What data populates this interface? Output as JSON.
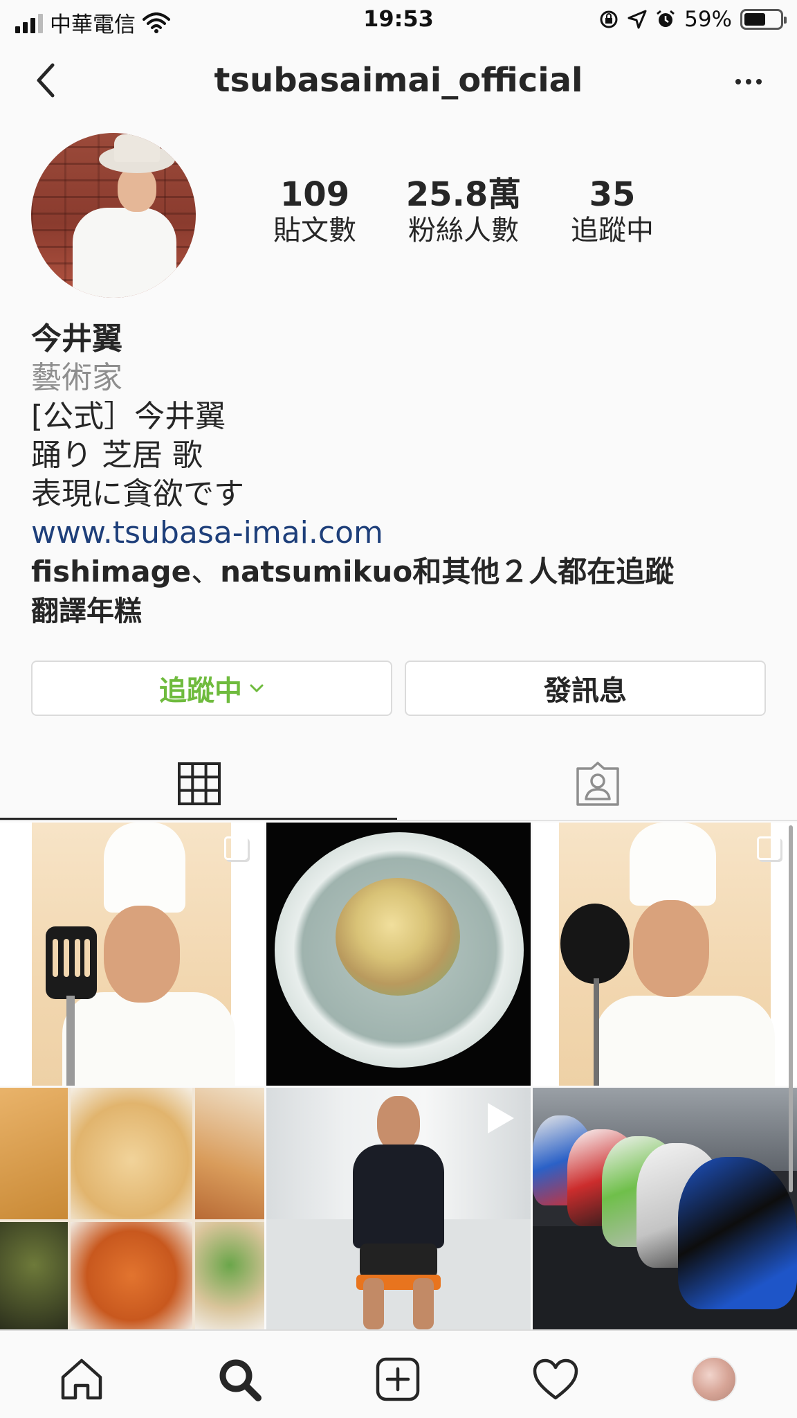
{
  "status_bar": {
    "carrier": "中華電信",
    "time": "19:53",
    "battery_percent": "59%",
    "battery_level": 0.59,
    "icons": [
      "signal-icon",
      "wifi-icon",
      "screen-lock-icon",
      "location-icon",
      "alarm-icon",
      "battery-icon"
    ]
  },
  "header": {
    "username": "tsubasaimai_official",
    "back_icon": "chevron-left-icon",
    "more_icon": "more-horizontal-icon"
  },
  "profile": {
    "stats": [
      {
        "value": "109",
        "label": "貼文數"
      },
      {
        "value": "25.8萬",
        "label": "粉絲人數"
      },
      {
        "value": "35",
        "label": "追蹤中"
      }
    ],
    "name": "今井翼",
    "category": "藝術家",
    "bio_lines": [
      "[公式］今井翼",
      "踊り 芝居 歌",
      "表現に貪欲です"
    ],
    "website": "www.tsubasa-imai.com",
    "followed_by": {
      "user1": "fishimage",
      "separator": "、",
      "user2": "natsumikuo",
      "suffix": "和其他２人都在追蹤"
    },
    "translate": "翻譯年糕"
  },
  "actions": {
    "following_label": "追蹤中",
    "message_label": "發訊息",
    "following_color": "#6fbb3e"
  },
  "tabs": [
    {
      "name": "posts-grid",
      "icon": "grid-icon",
      "active": true
    },
    {
      "name": "tagged",
      "icon": "tagged-person-icon",
      "active": false
    }
  ],
  "posts": [
    {
      "kind": "image",
      "multi": true
    },
    {
      "kind": "image",
      "multi": false
    },
    {
      "kind": "image",
      "multi": true
    },
    {
      "kind": "image",
      "multi": false
    },
    {
      "kind": "video",
      "multi": false
    },
    {
      "kind": "image",
      "multi": false
    }
  ],
  "bottom_nav": [
    {
      "icon": "home-icon"
    },
    {
      "icon": "search-icon",
      "active": true
    },
    {
      "icon": "add-post-icon"
    },
    {
      "icon": "heart-icon"
    },
    {
      "icon": "profile-avatar"
    }
  ]
}
